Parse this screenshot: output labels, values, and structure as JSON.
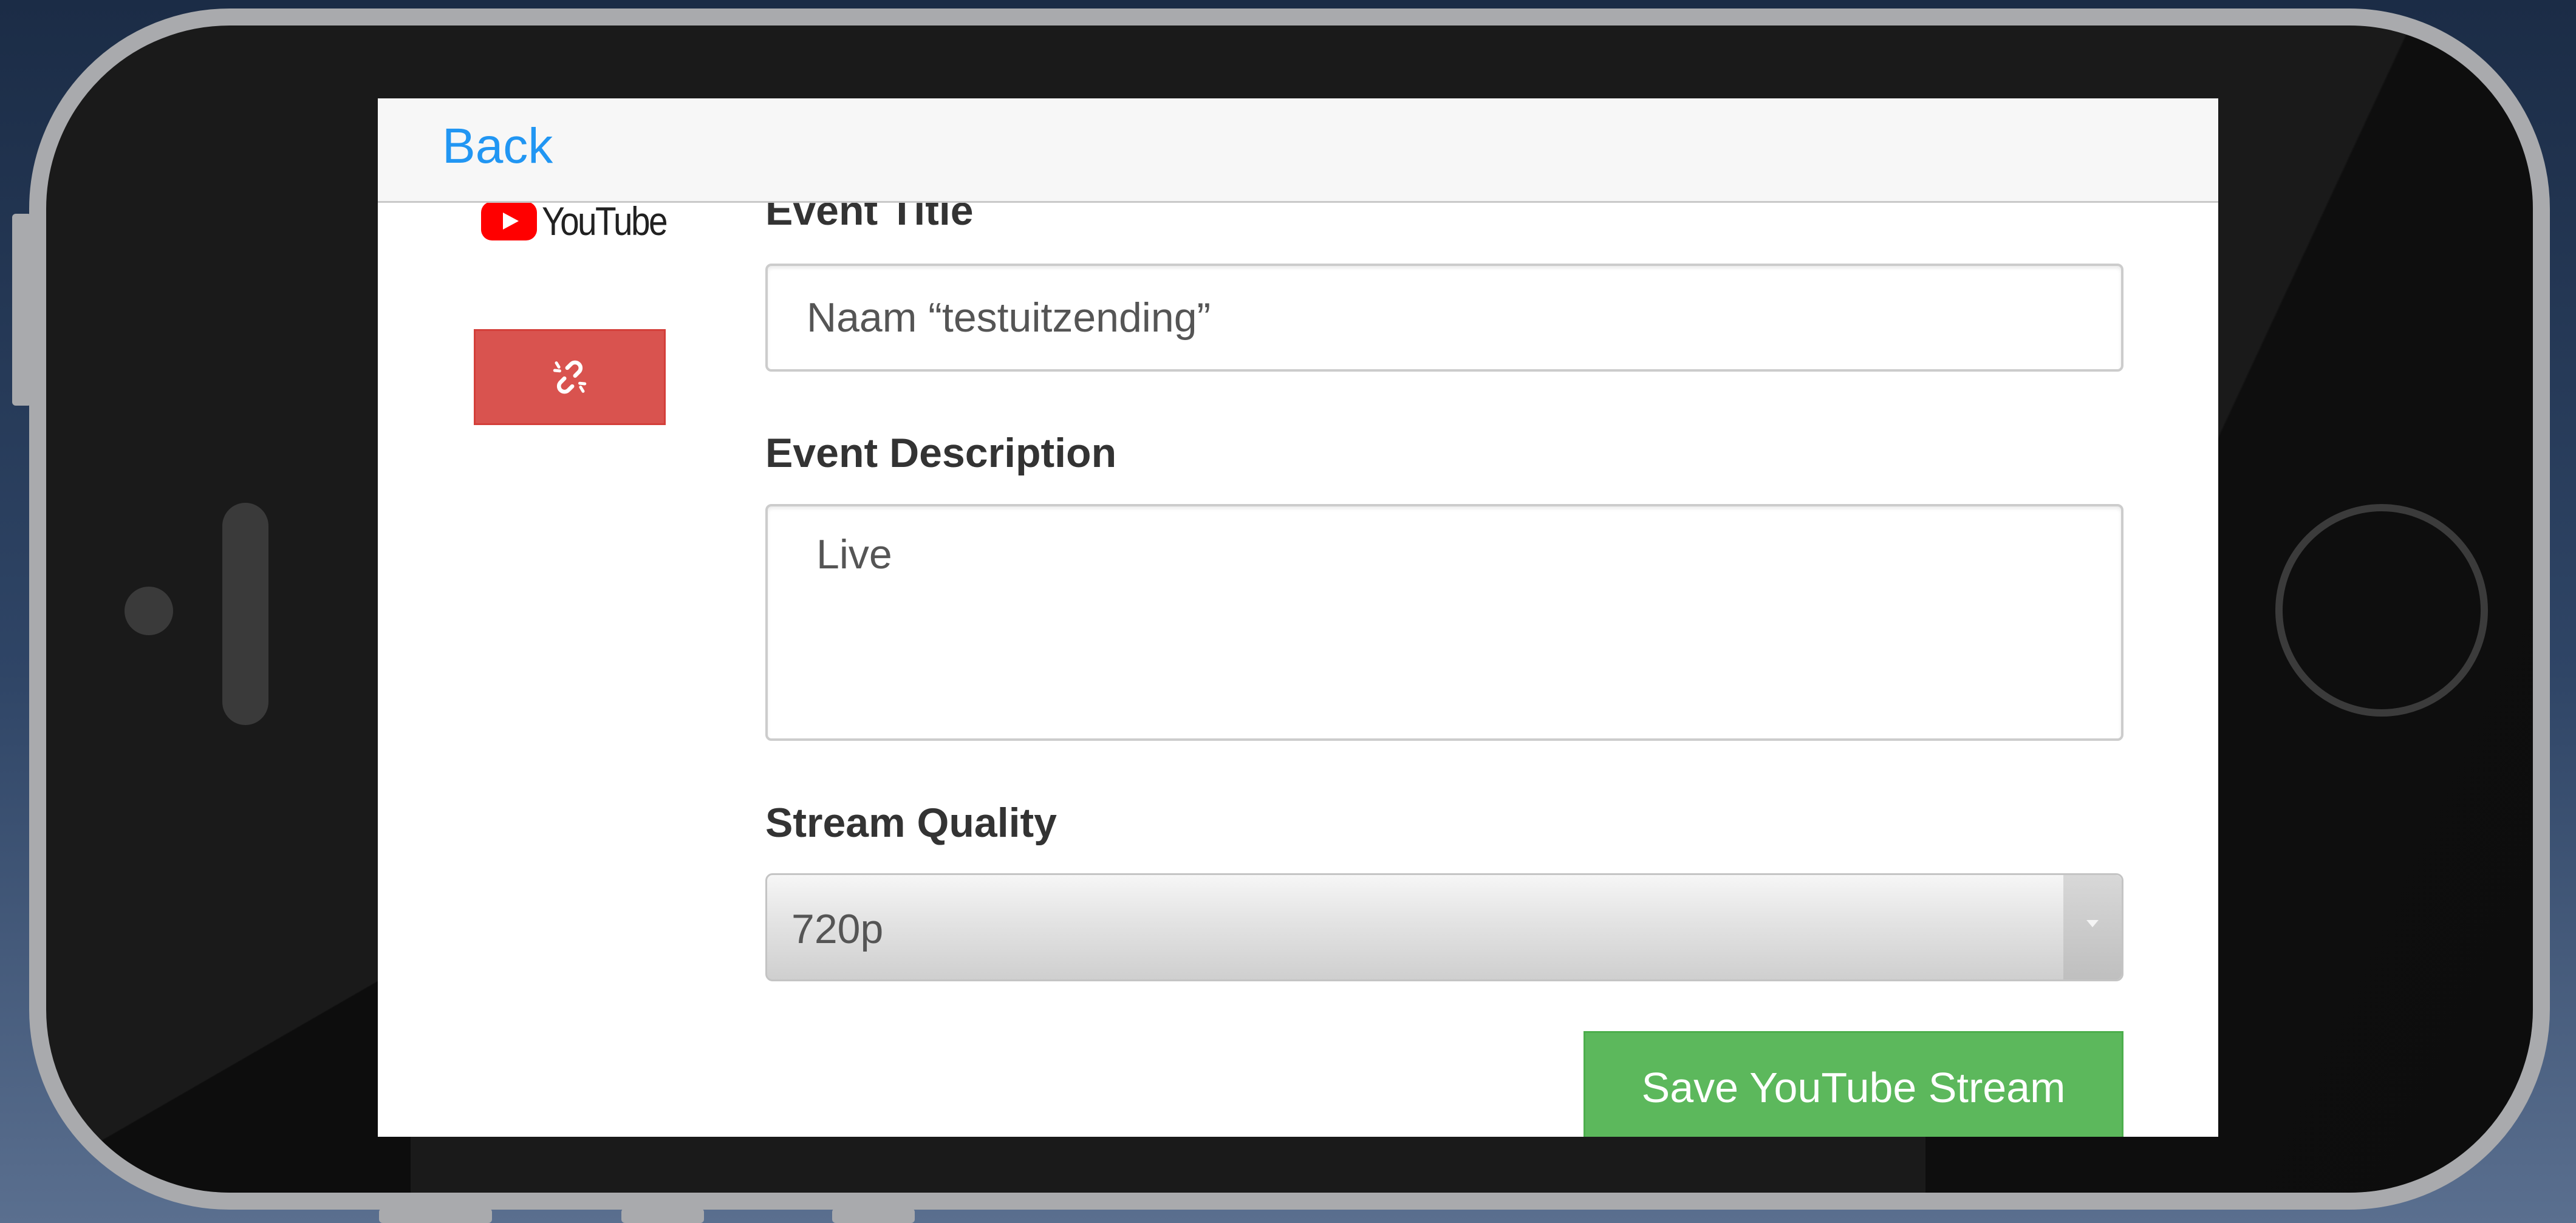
{
  "nav": {
    "back_label": "Back"
  },
  "sidebar": {
    "youtube_logo": "YouTube",
    "unlink_icon": "unlink-icon"
  },
  "form": {
    "event_title_label": "Event Title",
    "event_title_value": "Naam “testuitzending”",
    "event_description_label": "Event Description",
    "event_description_value": "Live",
    "stream_quality_label": "Stream Quality",
    "stream_quality_selected": "720p",
    "save_button_label": "Save YouTube Stream"
  },
  "colors": {
    "link_blue": "#2196f3",
    "danger_red": "#d9534f",
    "success_green": "#5cb85c",
    "youtube_red": "#ff0000"
  }
}
